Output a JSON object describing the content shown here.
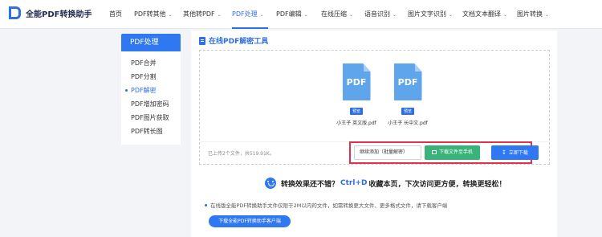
{
  "brand": {
    "name": "全能PDF转换助手",
    "logo_icon": "brand-logo-icon"
  },
  "nav": [
    {
      "label": "首页",
      "has_menu": false
    },
    {
      "label": "PDF转其他",
      "has_menu": true
    },
    {
      "label": "其他转PDF",
      "has_menu": true
    },
    {
      "label": "PDF处理",
      "has_menu": true,
      "active": true
    },
    {
      "label": "PDF编辑",
      "has_menu": true
    },
    {
      "label": "在线压缩",
      "has_menu": true
    },
    {
      "label": "语音识别",
      "has_menu": true
    },
    {
      "label": "图片文字识别",
      "has_menu": true
    },
    {
      "label": "文档文本翻译",
      "has_menu": true
    },
    {
      "label": "图片转换",
      "has_menu": true
    }
  ],
  "sidebar": {
    "title": "PDF处理",
    "items": [
      {
        "label": "PDF合并"
      },
      {
        "label": "PDF分割"
      },
      {
        "label": "PDF解密",
        "active": true
      },
      {
        "label": "PDF增加密码"
      },
      {
        "label": "PDF图片获取"
      },
      {
        "label": "PDF转长图"
      }
    ]
  },
  "tool": {
    "title": "在线PDF解密工具"
  },
  "files": [
    {
      "icon_text": "PDF",
      "preview": "预览",
      "name": "小王子 英文版.pdf"
    },
    {
      "icon_text": "PDF",
      "preview": "预览",
      "name": "小王子 长中文.pdf"
    }
  ],
  "upload": {
    "info": "已上传2个文件，共519.91K。"
  },
  "actions": {
    "continue": "继续添加（批量解密）",
    "to_mobile": "下载文件至手机",
    "download": "立即下载"
  },
  "promo": {
    "before": "转换效果还不错？",
    "shortcut": "Ctrl+D",
    "after": "收藏本页，下次访问更方便，转换更轻松！"
  },
  "notice": "在线版全能PDF转换助手文件仅限于2M以内的文件，如需转换更大文件、更多格式文件，请下载客户端",
  "client_button": "下载全能PDF转换助手客户端",
  "colors": {
    "accent": "#2f78f2",
    "green": "#3ab37a",
    "highlight": "#e4314b"
  }
}
